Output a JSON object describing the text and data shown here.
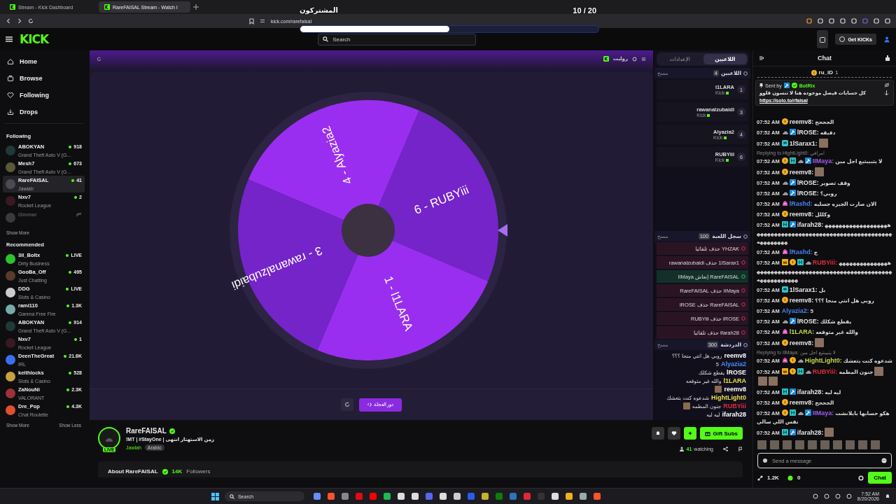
{
  "browser": {
    "tabs": [
      {
        "title": "Stream - Kick Dashboard",
        "selected": false
      },
      {
        "title": "RareFAISAL Stream - Watch l",
        "selected": true
      }
    ],
    "url": "kick.com/rarefaisal"
  },
  "overlay": {
    "label": "المشتركون",
    "count": "10 / 20",
    "level": 0.5
  },
  "header": {
    "logo": "KICK",
    "search_placeholder": "Search",
    "button": "Get KICKs"
  },
  "sidebar": {
    "nav": [
      {
        "label": "Home",
        "kind": "home"
      },
      {
        "label": "Browse",
        "kind": "browse"
      },
      {
        "label": "Following",
        "kind": "following"
      },
      {
        "label": "Drops",
        "kind": "drops"
      }
    ],
    "following_title": "Following",
    "following": [
      {
        "name": "ABOKYAN",
        "category": "Grand Theft Auto V (G...",
        "viewers": "918",
        "live": true,
        "selected": false
      },
      {
        "name": "Mesh7",
        "category": "Grand Theft Auto V (G...",
        "viewers": "673",
        "live": true,
        "selected": false
      },
      {
        "name": "RareFAISAL",
        "category": "Jawlah",
        "viewers": "41",
        "live": true,
        "selected": true
      },
      {
        "name": "Nxv7",
        "category": "Rocket League",
        "viewers": "2",
        "live": true,
        "selected": false
      },
      {
        "name": "l3mmar",
        "live": false,
        "selected": false
      }
    ],
    "following_more": "Show More",
    "recommended_title": "Recommended",
    "recommended": [
      {
        "name": "3il_Boltx",
        "category": "Dirty Business",
        "viewers": "LIVE",
        "live": true,
        "selected": false
      },
      {
        "name": "GooBa_Off",
        "category": "Just Chatting",
        "viewers": "495",
        "live": true,
        "selected": false
      },
      {
        "name": "DDG",
        "category": "Slots & Casino",
        "viewers": "LIVE",
        "live": true,
        "selected": false
      },
      {
        "name": "rami110",
        "category": "Garena Free Fire",
        "viewers": "1.3K",
        "live": true,
        "selected": false
      },
      {
        "name": "ABOKYAN",
        "category": "Grand Theft Auto V (G...",
        "viewers": "914",
        "live": true,
        "selected": false
      },
      {
        "name": "Nxv7",
        "category": "Rocket League",
        "viewers": "1",
        "live": true,
        "selected": false
      },
      {
        "name": "DeenTheGreat",
        "category": "IRL",
        "viewers": "21.6K",
        "live": true,
        "selected": false
      },
      {
        "name": "keithlocks",
        "category": "Slots & Casino",
        "viewers": "528",
        "live": true,
        "selected": false
      },
      {
        "name": "ZaNouNi",
        "category": "VALORANT",
        "viewers": "2.3K",
        "live": true,
        "selected": false
      },
      {
        "name": "Dre_Pop",
        "category": "Chat Roulette",
        "viewers": "4.3K",
        "live": true,
        "selected": false
      }
    ],
    "recommended_more": "Show More",
    "recommended_less": "Show Less"
  },
  "stage": {
    "app_title": "روليت",
    "segments": [
      {
        "label": "6 - RUBYiii",
        "color": "#7424c9"
      },
      {
        "label": "1 - l1LARA",
        "color": "#9a2ef0"
      },
      {
        "label": "3 - rawanalzubaidi",
        "color": "#7424c9"
      },
      {
        "label": "4 - Alyazia2",
        "color": "#9a2ef0"
      }
    ],
    "spin_button": "دور العجلة",
    "panel": {
      "tabs": [
        {
          "label": "اللاعبين",
          "selected": true
        },
        {
          "label": "الإعدادات",
          "selected": false
        }
      ],
      "players_title": "اللاعبين",
      "players_count": "4",
      "players_clear": "مسح",
      "players": [
        {
          "number": "1",
          "name": "l1LARA",
          "platform": "Kick"
        },
        {
          "number": "3",
          "name": "rawanalzubaidi",
          "platform": "Kick"
        },
        {
          "number": "4",
          "name": "Alyazia2",
          "platform": "Kick"
        },
        {
          "number": "6",
          "name": "RUBYiii",
          "platform": "Kick"
        }
      ],
      "history_title": "سجل اللعبة",
      "history_count": "100",
      "history_clear": "مسح",
      "history": [
        {
          "text": "YHZAK حذف تلقائيا",
          "kind": "eliminate"
        },
        {
          "text": "1lSarax1 حذف rawanalzubaidi",
          "kind": "eliminate"
        },
        {
          "text": "RareFAISAL إنعاش IIMaya",
          "kind": "revive"
        },
        {
          "text": "IIMaya حذف RareFAISAL",
          "kind": "eliminate"
        },
        {
          "text": "RareFAISAL حذف lROSE",
          "kind": "eliminate"
        },
        {
          "text": "lROSE حذف RUBYiii",
          "kind": "eliminate"
        },
        {
          "text": "ifarah28 حذف تلقائيا",
          "kind": "eliminate"
        }
      ],
      "chat_title": "الدردشة",
      "chat_count": "300",
      "chat_clear": "مسح",
      "chat": [
        {
          "user": "reemv8",
          "color": "#ffffff",
          "text": "روبي هل انتي منحا ؟؟؟"
        },
        {
          "user": "Alyazia2",
          "color": "#4a8cf0",
          "text": "5"
        },
        {
          "user": "lROSE",
          "color": "#ffffff",
          "text": "يقطع شكلك"
        },
        {
          "user": "l1LARA",
          "color": "#e8e04a",
          "text": "والله غير متوقعه"
        },
        {
          "user": "reemv8",
          "color": "#ffffff",
          "emotes": [
            {
              "kind": "image"
            }
          ]
        },
        {
          "user": "HightLight0",
          "color": "#e8e04a",
          "text": "شدعوه كنت بتعشك"
        },
        {
          "user": "RUBYiii",
          "color": "#e0283c",
          "text": "جنون المطمه",
          "emotes": [
            {
              "kind": "image"
            }
          ]
        },
        {
          "user": "ifarah28",
          "color": "#ffffff",
          "text": "ليه ليه"
        }
      ]
    }
  },
  "info": {
    "name": "RareFAISAL",
    "live_badge": "LIVE",
    "title": "!MT | #StayOne | زمن الاستهتار انتهى",
    "category": "Jawlah",
    "tag": "Arabic",
    "gift_button": "Gift Subs",
    "viewers": "41",
    "viewers_label": "watching",
    "about": "About RareFAISAL",
    "followers": "14K",
    "followers_label": "Followers"
  },
  "chat": {
    "title": "Chat",
    "top_gifter": {
      "user": "ru_iD",
      "count": "1"
    },
    "pinned": {
      "sent_by": "Sent by",
      "user": "BotRix",
      "text": "كل حسابات فيصل موجوده هنا لا تنسون فلوو",
      "link": "https://solo.to/rfaisal"
    },
    "messages": [
      {
        "time": "07:52 AM",
        "badges": [
          {
            "kind": "sub"
          }
        ],
        "user": "reemv8:",
        "color": "#e6e6e6",
        "text": "الحححح"
      },
      {
        "time": "07:52 AM",
        "badges": [
          {
            "kind": "cloud"
          },
          {
            "kind": "mod"
          }
        ],
        "user": "lROSE:",
        "color": "#e6e6e6",
        "text": "دقيقه"
      },
      {
        "time": "07:52 AM",
        "badges": [
          {
            "kind": "kick"
          }
        ],
        "user": "1lSarax1:",
        "color": "#e6e6e6",
        "emotes": [
          {
            "kind": "image"
          }
        ]
      },
      {
        "time": "07:52 AM",
        "reply": "Replying to HightLight0: مرافي!",
        "badges": [
          {
            "kind": "sub"
          },
          {
            "kind": "gift"
          },
          {
            "kind": "cloud"
          },
          {
            "kind": "mod"
          }
        ],
        "user": "IIMaya:",
        "color": "#a25cf0",
        "text": "لا يتبيبتيع اجل مين"
      },
      {
        "time": "07:52 AM",
        "badges": [
          {
            "kind": "sub"
          }
        ],
        "user": "reemv8:",
        "color": "#e6e6e6",
        "emotes": [
          {
            "kind": "image"
          }
        ]
      },
      {
        "time": "07:52 AM",
        "badges": [
          {
            "kind": "cloud"
          },
          {
            "kind": "mod"
          }
        ],
        "user": "lROSE:",
        "color": "#e6e6e6",
        "text": "وقف تصوير"
      },
      {
        "time": "07:52 AM",
        "badges": [
          {
            "kind": "cloud"
          },
          {
            "kind": "mod"
          }
        ],
        "user": "lROSE:",
        "color": "#e6e6e6",
        "text": "روبي؟"
      },
      {
        "time": "07:52 AM",
        "badges": [
          {
            "kind": "pink"
          }
        ],
        "user": "lRashd:",
        "color": "#4a7ff0",
        "text": "الان صارت الجيزه جسليه"
      },
      {
        "time": "07:52 AM",
        "badges": [
          {
            "kind": "sub"
          }
        ],
        "user": "reemv8:",
        "color": "#e6e6e6",
        "text": "وكللل"
      },
      {
        "time": "07:52 AM",
        "badges": [
          {
            "kind": "gift"
          },
          {
            "kind": "mod"
          }
        ],
        "user": "ifarah28:",
        "color": "#e6e6e6",
        "text": "ههههههههههههههههههههههههههههههههههههههههههههههههههههههههههههههههههه"
      },
      {
        "time": "07:52 AM",
        "badges": [
          {
            "kind": "pink"
          }
        ],
        "user": "lRashd:",
        "color": "#4a7ff0",
        "text": "ج"
      },
      {
        "time": "07:52 AM",
        "badges": [
          {
            "kind": "crown"
          },
          {
            "kind": "sub"
          },
          {
            "kind": "gift"
          },
          {
            "kind": "cloud"
          }
        ],
        "user": "RUBYiii:",
        "color": "#e0283c",
        "text": "هههههههههههههههههههههههههههههههههههههههههههههههههههههههههههههههههه"
      },
      {
        "time": "07:52 AM",
        "badges": [
          {
            "kind": "kick"
          }
        ],
        "user": "1lSarax1:",
        "color": "#e6e6e6",
        "text": "بل"
      },
      {
        "time": "07:52 AM",
        "badges": [
          {
            "kind": "sub"
          }
        ],
        "user": "reemv8:",
        "color": "#e6e6e6",
        "text": "روبي هل انتي منحا ؟؟؟"
      },
      {
        "time": "07:52 AM",
        "user": "Alyazia2:",
        "color": "#4a7ff0",
        "text": "5"
      },
      {
        "time": "07:52 AM",
        "badges": [
          {
            "kind": "cloud"
          },
          {
            "kind": "mod"
          }
        ],
        "user": "lROSE:",
        "color": "#e6e6e6",
        "text": "يقطع شكلك"
      },
      {
        "time": "07:52 AM",
        "badges": [
          {
            "kind": "pink"
          }
        ],
        "user": "l1LARA:",
        "color": "#c8d84a",
        "text": "والله غير متوقعه"
      },
      {
        "time": "07:52 AM",
        "badges": [
          {
            "kind": "sub"
          }
        ],
        "user": "reemv8:",
        "color": "#e6e6e6",
        "emotes": [
          {
            "kind": "image"
          }
        ]
      },
      {
        "time": "07:52 AM",
        "reply": "Replying to IIMaya: لا يتبيبتيع اجل مين",
        "badges": [
          {
            "kind": "pink"
          },
          {
            "kind": "sub"
          },
          {
            "kind": "cloud"
          }
        ],
        "user": "HightLight0:",
        "color": "#c8d84a",
        "text": "شدعوه كنت بتعشك"
      },
      {
        "time": "07:52 AM",
        "badges": [
          {
            "kind": "crown"
          },
          {
            "kind": "sub"
          },
          {
            "kind": "gift"
          },
          {
            "kind": "cloud"
          }
        ],
        "user": "RUBYiii:",
        "color": "#e0283c",
        "text": "جنون المطمه",
        "emotes": [
          {
            "kind": "image"
          },
          {
            "kind": "image"
          },
          {
            "kind": "image"
          }
        ]
      },
      {
        "time": "07:52 AM",
        "badges": [
          {
            "kind": "gift"
          },
          {
            "kind": "mod"
          }
        ],
        "user": "ifarah28:",
        "color": "#e6e6e6",
        "text": "ليه ليه"
      },
      {
        "time": "07:52 AM",
        "badges": [
          {
            "kind": "sub"
          }
        ],
        "user": "reemv8:",
        "color": "#e6e6e6",
        "text": "الحححح"
      },
      {
        "time": "07:52 AM",
        "badges": [
          {
            "kind": "sub"
          },
          {
            "kind": "gift"
          },
          {
            "kind": "cloud"
          },
          {
            "kind": "mod"
          }
        ],
        "user": "IIMaya:",
        "color": "#a25cf0",
        "text": "هكو حسابها بايلانشت نفس اللي سالي"
      },
      {
        "time": "07:52 AM",
        "badges": [
          {
            "kind": "gift"
          },
          {
            "kind": "mod"
          }
        ],
        "user": "ifarah28:",
        "color": "#e6e6e6",
        "emotes": [
          {
            "kind": "image"
          }
        ]
      }
    ],
    "emote_bar": [
      {
        "kind": "image"
      },
      {
        "kind": "image"
      },
      {
        "kind": "image"
      },
      {
        "kind": "image"
      },
      {
        "kind": "image"
      },
      {
        "kind": "image"
      },
      {
        "kind": "image"
      },
      {
        "kind": "image"
      },
      {
        "kind": "image"
      },
      {
        "kind": "image"
      }
    ],
    "input_placeholder": "Send a message",
    "points": "1.2K",
    "kicks": "0",
    "send_button": "Chat"
  },
  "taskbar": {
    "search": "Search",
    "time": "7:52 AM",
    "date": "8/20/2026"
  }
}
